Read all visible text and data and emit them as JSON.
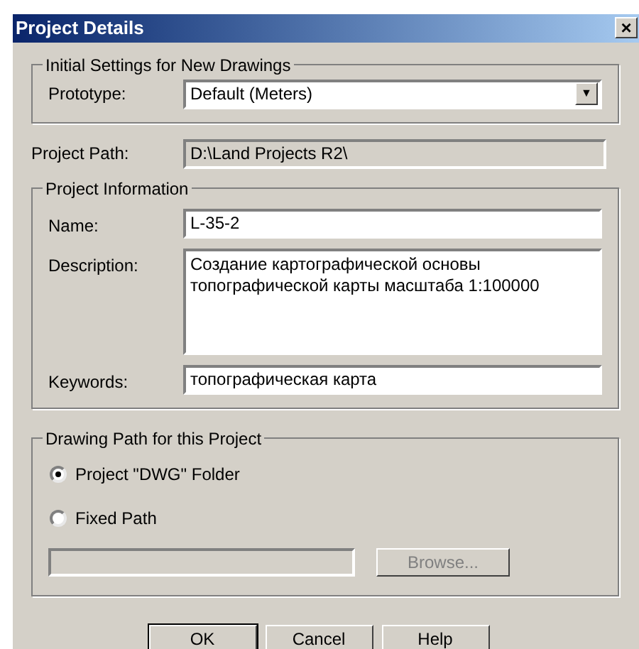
{
  "window": {
    "title": "Project Details",
    "close": "×"
  },
  "initial_settings": {
    "legend": "Initial Settings for New Drawings",
    "prototype": {
      "label": "Prototype:",
      "value": "Default (Meters)",
      "arrow": "▼"
    }
  },
  "project_path": {
    "label": "Project Path:",
    "value": "D:\\Land Projects R2\\",
    "disabled": true
  },
  "project_information": {
    "legend": "Project Information",
    "fields": [
      {
        "kind": "line",
        "label": "Name:",
        "value": "L-35-2"
      },
      {
        "kind": "area",
        "label": "Description:",
        "value": "Создание картографической основы  топографической карты масштаба 1:100000"
      },
      {
        "kind": "line",
        "label": "Keywords:",
        "value": "топографическая карта"
      }
    ]
  },
  "drawing_path": {
    "legend": "Drawing Path for this Project",
    "options": [
      {
        "label": "Project \"DWG\" Folder",
        "selected": true
      },
      {
        "label": "Fixed Path",
        "selected": false
      }
    ],
    "fixed_path_field": {
      "disabled": true
    },
    "browse_button": {
      "label": "Browse...",
      "disabled": true
    }
  },
  "buttons": [
    "OK",
    "Cancel",
    "Help"
  ]
}
